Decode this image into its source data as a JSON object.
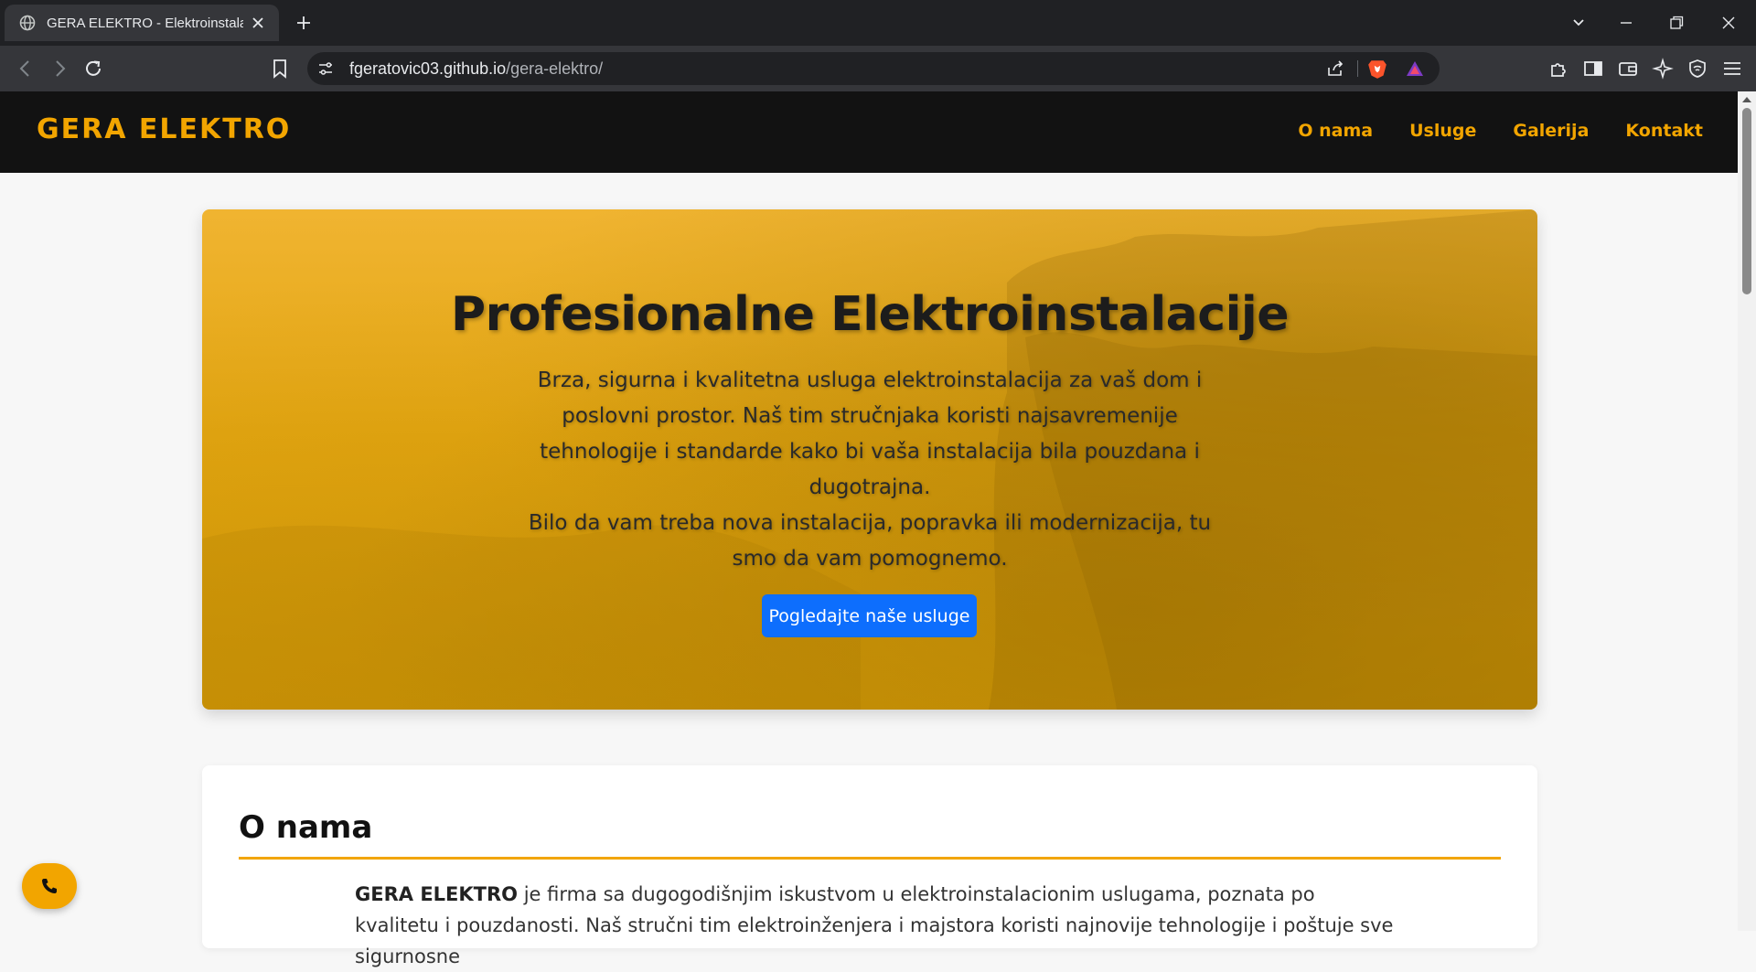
{
  "browser": {
    "tab_title": "GERA ELEKTRO - Elektroinstalacije",
    "url_host": "fgeratovic03.github.io",
    "url_path": "/gera-elektro/"
  },
  "navbar": {
    "brand": "GERA ELEKTRO",
    "links": [
      "O nama",
      "Usluge",
      "Galerija",
      "Kontakt"
    ]
  },
  "hero": {
    "title": "Profesionalne Elektroinstalacije",
    "paragraph1": "Brza, sigurna i kvalitetna usluga elektroinstalacija za vaš dom i poslovni prostor. Naš tim stručnjaka koristi najsavremenije tehnologije i standarde kako bi vaša instalacija bila pouzdana i dugotrajna.",
    "paragraph2": "Bilo da vam treba nova instalacija, popravka ili modernizacija, tu smo da vam pomognemo.",
    "button": "Pogledajte naše usluge"
  },
  "about": {
    "title": "O nama",
    "company": "GERA ELEKTRO",
    "text": " je firma sa dugogodišnjim iskustvom u elektroinstalacionim uslugama, poznata po kvalitetu i pouzdanosti. Naš stručni tim elektroinženjera i majstora koristi najnovije tehnologije i poštuje sve sigurnosne"
  },
  "colors": {
    "accent": "#f2a500",
    "navbar_bg": "#121212",
    "button_blue": "#0d6efd"
  },
  "icons": [
    "globe-icon",
    "close-icon",
    "plus-icon",
    "back-icon",
    "forward-icon",
    "reload-icon",
    "bookmark-icon",
    "site-settings-icon",
    "share-icon",
    "brave-icon",
    "rewards-icon",
    "extensions-icon",
    "sidebar-icon",
    "wallet-icon",
    "leo-icon",
    "vpn-icon",
    "menu-icon",
    "phone-icon"
  ]
}
